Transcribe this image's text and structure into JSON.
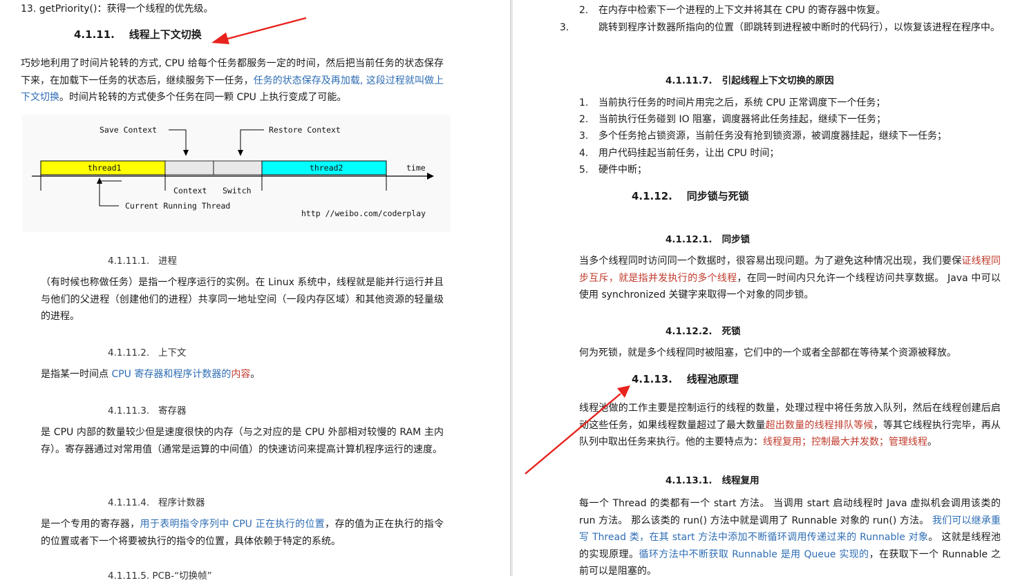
{
  "left": {
    "item13": "13.  getPriority()：获得一个线程的优先级。",
    "sec_4_1_11": {
      "num": "4.1.11.",
      "title": "线程上下文切换"
    },
    "intro": {
      "part1": "巧妙地利用了时间片轮转的方式, CPU 给每个任务都服务一定的时间，然后把当前任务的状态保存下来，在加载下一任务的状态后，继续服务下一任务，",
      "part2_blue": "任务的状态保存及再加载, 这段过程就叫做上下文切换",
      "part3": "。时间片轮转的方式使多个任务在同一颗 CPU 上执行变成了可能。"
    },
    "diagram": {
      "save_context": "Save Context",
      "restore_context": "Restore Context",
      "thread1": "thread1",
      "thread2": "thread2",
      "time": "time",
      "context": "Context",
      "switch": "Switch",
      "current_running_thread": "Current Running Thread",
      "watermark": "http //weibo.com/coderplay",
      "colors": {
        "thread1": "#ffff00",
        "thread2": "#00ffff",
        "switch": "#e8e8e8"
      }
    },
    "s1": {
      "num": "4.1.11.1.",
      "title": "进程",
      "body": "（有时候也称做任务）是指一个程序运行的实例。在 Linux 系统中，线程就是能并行运行并且与他们的父进程（创建他们的进程）共享同一地址空间（一段内存区域）和其他资源的轻量级的进程。"
    },
    "s2": {
      "num": "4.1.11.2.",
      "title": "上下文",
      "body1": "是指某一时间点 ",
      "body_blue": "CPU 寄存器和程序计数器的",
      "body_red": "内容",
      "body2": "。"
    },
    "s3": {
      "num": "4.1.11.3.",
      "title": "寄存器",
      "body": "是 CPU 内部的数量较少但是速度很快的内存（与之对应的是 CPU 外部相对较慢的 RAM 主内存）。寄存器通过对常用值（通常是运算的中间值）的快速访问来提高计算机程序运行的速度。"
    },
    "s4": {
      "num": "4.1.11.4.",
      "title": "程序计数器",
      "body1": "是一个专用的寄存器，",
      "body_blue": "用于表明指令序列中 CPU 正在执行的位置",
      "body2": "，存的值为正在执行的指令的位置或者下一个将要被执行的指令的位置，具体依赖于特定的系统。"
    },
    "s5_partial": "4.1.11.5.   PCB-“切换帧”"
  },
  "right": {
    "steps": [
      {
        "n": "2.",
        "text": "在内存中检索下一个进程的上下文并将其在 CPU 的寄存器中恢复。"
      },
      {
        "n": "3.",
        "text": "跳转到程序计数器所指向的位置（即跳转到进程被中断时的代码行），以恢复该进程在程序中。"
      }
    ],
    "s7": {
      "num": "4.1.11.7.",
      "title": "引起线程上下文切换的原因"
    },
    "reasons": [
      {
        "n": "1.",
        "text": "当前执行任务的时间片用完之后，系统 CPU 正常调度下一个任务；"
      },
      {
        "n": "2.",
        "text": "当前执行任务碰到 IO 阻塞，调度器将此任务挂起，继续下一任务；"
      },
      {
        "n": "3.",
        "text": "多个任务抢占锁资源，当前任务没有抢到锁资源，被调度器挂起，继续下一任务；"
      },
      {
        "n": "4.",
        "text": "用户代码挂起当前任务，让出 CPU 时间；"
      },
      {
        "n": "5.",
        "text": "硬件中断；"
      }
    ],
    "sec_4_1_12": {
      "num": "4.1.12.",
      "title": "同步锁与死锁"
    },
    "s12_1": {
      "num": "4.1.12.1.",
      "title": "同步锁",
      "body1": "当多个线程同时访问同一个数据时，很容易出现问题。为了避免这种情况出现，我们要保",
      "body_red": "证线程同步互斥，就是指并发执行的多个线程",
      "body2": "，在同一时间内只允许一个线程访问共享数据。 Java 中可以使用 synchronized 关键字来取得一个对象的同步锁。"
    },
    "s12_2": {
      "num": "4.1.12.2.",
      "title": "死锁",
      "body": "何为死锁，就是多个线程同时被阻塞，它们中的一个或者全部都在等待某个资源被释放。"
    },
    "sec_4_1_13": {
      "num": "4.1.13.",
      "title": "线程池原理"
    },
    "pool": {
      "body1": "线程池做的工作主要是控制运行的线程的数量，处理过程中将任务放入队列，然后在线程创建后启动这些任务，如果线程数量超过了最大数量",
      "body_red": "超出数量的线程排队等候",
      "body2": "，等其它线程执行完毕，再从队列中取出任务来执行。他的主要特点为：",
      "body_red2": "线程复用；控制最大并发数；管理线程",
      "body3": "。"
    },
    "s13_1": {
      "num": "4.1.13.1.",
      "title": "线程复用",
      "body1": "每一个 Thread 的类都有一个 start 方法。 当调用 start 启动线程时 Java 虚拟机会调用该类的 run 方法。 那么该类的 run() 方法中就是调用了 Runnable 对象的 run() 方法。 ",
      "body_blue": "我们可以继承重写 Thread 类，在其 start 方法中添加不断循环调用传递过来的 Runnable 对象",
      "body2": "。 这就是线程池的实现原理。",
      "body_blue2": "循环方法中不断获取 Runnable 是用 Queue 实现的",
      "body3": "，在获取下一个 Runnable 之前可以是阻塞的。"
    }
  },
  "annotation_color": "#e8231e"
}
